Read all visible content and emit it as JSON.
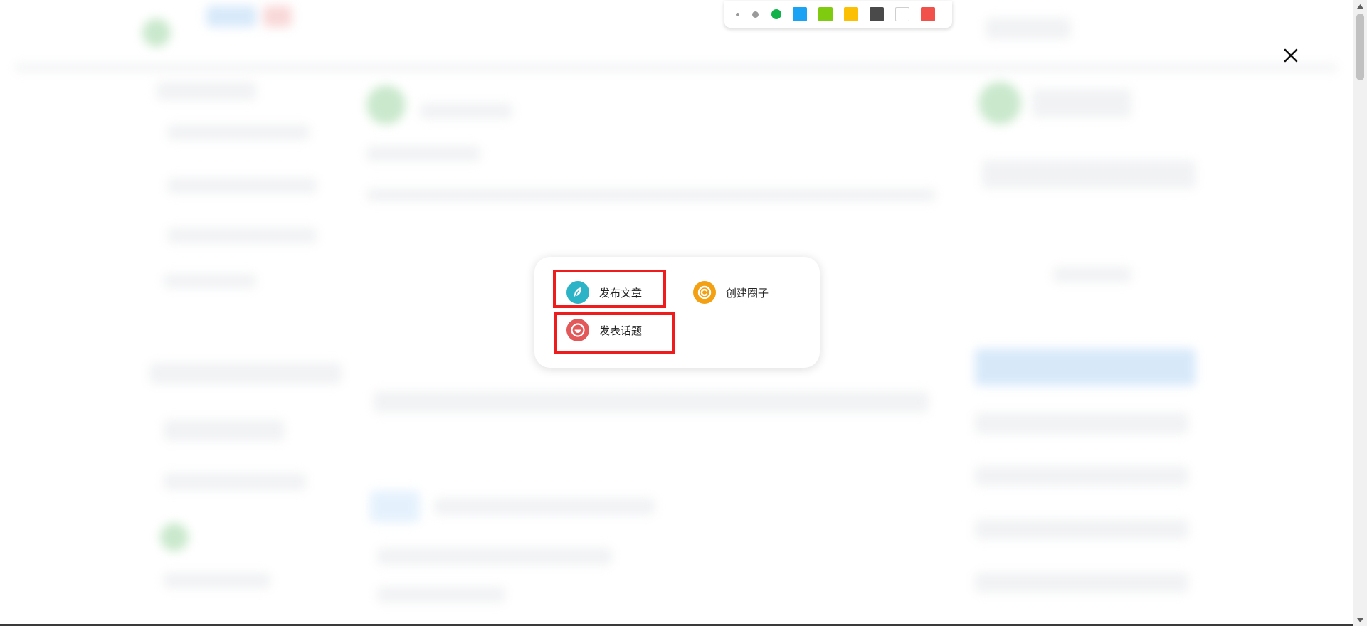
{
  "toolbar": {
    "pen_sizes": [
      "small",
      "medium",
      "large"
    ],
    "active_pen_color": "#12b24a",
    "swatches": [
      {
        "name": "blue",
        "color": "#1aa3f5"
      },
      {
        "name": "green",
        "color": "#7ecb0f"
      },
      {
        "name": "yellow",
        "color": "#fbbf04"
      },
      {
        "name": "dark-gray",
        "color": "#4a4a4a"
      },
      {
        "name": "white",
        "color": "#ffffff"
      },
      {
        "name": "red",
        "color": "#f2504a"
      }
    ]
  },
  "close_icon": "close-icon",
  "modal": {
    "options": {
      "publish_article": {
        "label": "发布文章",
        "icon": "feather-icon",
        "color": "#2cb4c6"
      },
      "create_circle": {
        "label": "创建圈子",
        "icon": "circle-c-icon",
        "color": "#f3a012"
      },
      "post_topic": {
        "label": "发表话题",
        "icon": "topic-bubble-icon",
        "color": "#e35858"
      }
    },
    "highlight_color": "#ee1c1c"
  }
}
